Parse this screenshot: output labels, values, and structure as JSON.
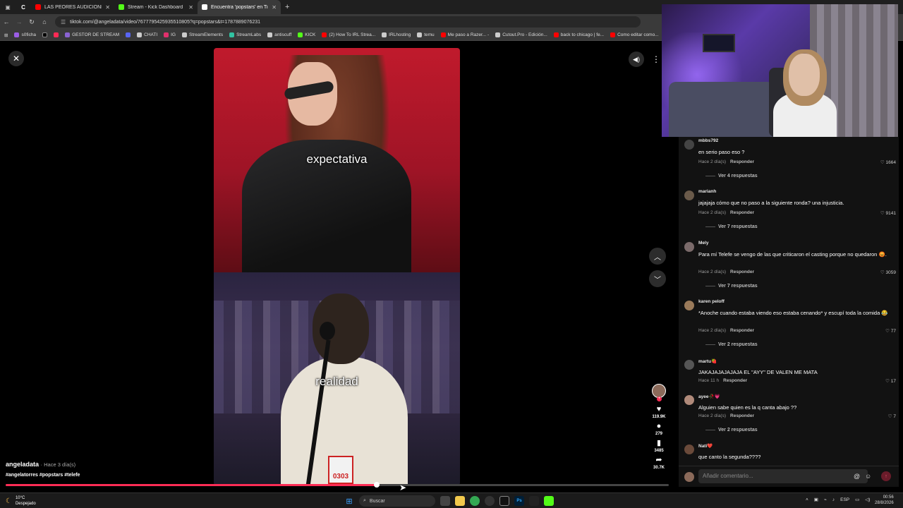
{
  "browser": {
    "tabs": [
      {
        "label": "LAS PEORES AUDICIONES DE P",
        "icon": "youtube-icon",
        "color": "#ff0000"
      },
      {
        "label": "Stream - Kick Dashboard",
        "icon": "kick-icon",
        "color": "#53fc18"
      },
      {
        "label": "Encuentra 'popstars' en Ti",
        "icon": "tiktok-icon",
        "color": "#ffffff",
        "active": true
      }
    ],
    "url": "tiktok.com/@angeladata/video/7677795425935510805?q=popstars&t=1787889076231",
    "bookmarks": [
      {
        "label": "s0ficha",
        "color": "#9b5de5"
      },
      {
        "label": "",
        "color": "#000000"
      },
      {
        "label": "",
        "color": "#ff2a55"
      },
      {
        "label": "GESTOR DE STREAM",
        "color": "#8a63d2"
      },
      {
        "label": "",
        "color": "#5865f2"
      },
      {
        "label": "CHATI",
        "color": "#cccccc"
      },
      {
        "label": "IG",
        "color": "#e1306c"
      },
      {
        "label": "StreamElements",
        "color": "#cccccc"
      },
      {
        "label": "StreamLabs",
        "color": "#31c3a2"
      },
      {
        "label": "antiscuff",
        "color": "#cccccc"
      },
      {
        "label": "KICK",
        "color": "#53fc18"
      },
      {
        "label": "(2) How To IRL Strea...",
        "color": "#ff0000"
      },
      {
        "label": "IRLhosting",
        "color": "#cccccc"
      },
      {
        "label": "temu",
        "color": "#cccccc"
      },
      {
        "label": "Me paso a Razer... -",
        "color": "#ff0000"
      },
      {
        "label": "Cutout.Pro - Edición...",
        "color": "#cccccc"
      },
      {
        "label": "back to chicago | fe...",
        "color": "#ff0000"
      },
      {
        "label": "Como editar como...",
        "color": "#ff0000"
      }
    ]
  },
  "video": {
    "caption_top": "expectativa",
    "caption_bottom": "realidad",
    "badge_number": "0303",
    "author": "angeladata",
    "ago": "· Hace 3 día(s)",
    "tags": "#angelatorres #popstars #telefe",
    "progress": 0.56,
    "likes": "119.9K",
    "comments_count": "279",
    "saves": "3485",
    "shares": "30.7K"
  },
  "comments": [
    {
      "user": "mbbs792",
      "text": "en serio paso eso ?",
      "time": "Hace 2 día(s)",
      "reply": "Responder",
      "likes": "1664",
      "replies": "Ver 4 respuestas",
      "avatar": "#444444"
    },
    {
      "user": "marianh",
      "text": "jajajaja cómo que no paso a la siguiente ronda? una injusticia.",
      "time": "Hace 2 día(s)",
      "reply": "Responder",
      "likes": "9141",
      "replies": "Ver 7 respuestas",
      "avatar": "#6a5a4a"
    },
    {
      "user": "Mely",
      "text": "Para mí Telefe se vengo de las que criticaron el casting porque no quedaron 😡.",
      "time": "Hace 2 día(s)",
      "reply": "Responder",
      "likes": "3059",
      "replies": "Ver 7 respuestas",
      "avatar": "#7a6a6a"
    },
    {
      "user": "karen peloff",
      "text": "*Anoche cuando estaba viendo eso estaba cenando* y escupí toda la comida 😂",
      "time": "Hace 2 día(s)",
      "reply": "Responder",
      "likes": "77",
      "replies": "Ver 2 respuestas",
      "avatar": "#9a7a5a"
    },
    {
      "user": "martu🍓",
      "text": "JAKAJAJAJAJAJA EL \"AYY\" DE VALEN ME MATA",
      "time": "Hace 11 h",
      "reply": "Responder",
      "likes": "17",
      "replies": "",
      "avatar": "#555555"
    },
    {
      "user": "ayee🥀💗",
      "text": "Alguien sabe quien es la q canta abajo ??",
      "time": "Hace 2 día(s)",
      "reply": "Responder",
      "likes": "7",
      "replies": "Ver 2 respuestas",
      "avatar": "#b08a7a"
    },
    {
      "user": "Nati❤️",
      "text": "que canto la segunda????",
      "time": "",
      "reply": "",
      "likes": "",
      "replies": "",
      "avatar": "#6a4a3a"
    }
  ],
  "comment_input": {
    "placeholder": "Añadir comentario..."
  },
  "taskbar": {
    "temp": "10°C",
    "weather": "Despejado",
    "search": "Buscar",
    "lang": "ESP",
    "time": "00:56",
    "date": "28/8/2026"
  }
}
